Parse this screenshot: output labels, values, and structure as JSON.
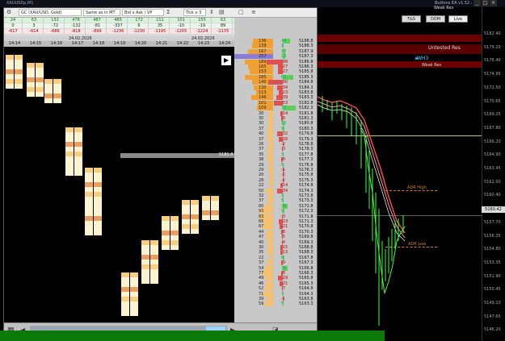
{
  "window": {
    "title": "XAUUSDp,M1",
    "buttons_ea_title": "Buttons EA v1.52 : Ho",
    "controls": [
      "_",
      "□",
      "×"
    ]
  },
  "toolbar": {
    "symbol": "GC (XAU/USD, Gold)",
    "feed": "Same as in MT",
    "mode": "Bid x Ask / VP",
    "tick": "Tick x 3"
  },
  "stats": {
    "rows": [
      [
        "24",
        "63",
        "132",
        "478",
        "487",
        "485",
        "172",
        "111",
        "101",
        "155",
        "63"
      ],
      [
        "0",
        "3",
        "-72",
        "-132",
        "-81",
        "-337",
        "6",
        "35",
        "-10",
        "-19",
        "89"
      ],
      [
        "-617",
        "-614",
        "-686",
        "-818",
        "-899",
        "-1236",
        "-1230",
        "-1195",
        "-1205",
        "-1224",
        "-1135"
      ]
    ]
  },
  "dates": {
    "left": "24.02.2026",
    "right": "24.02.2026"
  },
  "times": [
    "14:14",
    "14:15",
    "14:16",
    "14:17",
    "14:18",
    "14:19",
    "14:20",
    "14:21",
    "14:22",
    "14:23",
    "14:24"
  ],
  "fp_price_marker": "5181.6",
  "volume_profile": [
    {
      "p": "5188.8",
      "v": "136",
      "d": "44"
    },
    {
      "p": "5188.3",
      "v": "139",
      "d": "1"
    },
    {
      "p": "5187.9",
      "v": "167",
      "d": "17"
    },
    {
      "p": "5187.3",
      "v": "257",
      "d": "13"
    },
    {
      "p": "5186.8",
      "v": "189",
      "d": "-98"
    },
    {
      "p": "5186.3",
      "v": "165",
      "d": "-27"
    },
    {
      "p": "5185.8",
      "v": "153",
      "d": "-27"
    },
    {
      "p": "5185.3",
      "v": "185",
      "d": "62"
    },
    {
      "p": "5184.8",
      "v": "140",
      "d": "-90"
    },
    {
      "p": "5184.3",
      "v": "130",
      "d": "-34"
    },
    {
      "p": "5183.8",
      "v": "113",
      "d": "-23"
    },
    {
      "p": "5183.3",
      "v": "146",
      "d": "-39"
    },
    {
      "p": "5182.8",
      "v": "101",
      "d": "-53"
    },
    {
      "p": "5182.3",
      "v": "109",
      "d": "77"
    },
    {
      "p": "5181.8",
      "v": "30",
      "d": "-14"
    },
    {
      "p": "5181.3",
      "v": "30",
      "d": "-8"
    },
    {
      "p": "5180.8",
      "v": "30",
      "d": "12"
    },
    {
      "p": "5180.3",
      "v": "37",
      "d": "9"
    },
    {
      "p": "5179.8",
      "v": "40",
      "d": "-32"
    },
    {
      "p": "5179.3",
      "v": "37",
      "d": "-26"
    },
    {
      "p": "5178.8",
      "v": "26",
      "d": "-2"
    },
    {
      "p": "5178.3",
      "v": "37",
      "d": "-3"
    },
    {
      "p": "5177.8",
      "v": "35",
      "d": "3"
    },
    {
      "p": "5177.3",
      "v": "38",
      "d": "-8"
    },
    {
      "p": "5176.8",
      "v": "29",
      "d": "5"
    },
    {
      "p": "5176.3",
      "v": "29",
      "d": "-1"
    },
    {
      "p": "5175.8",
      "v": "20",
      "d": "-2"
    },
    {
      "p": "5175.3",
      "v": "28",
      "d": "-2"
    },
    {
      "p": "5174.8",
      "v": "22",
      "d": "-14"
    },
    {
      "p": "5174.3",
      "v": "50",
      "d": "-34"
    },
    {
      "p": "5173.8",
      "v": "32",
      "d": "2"
    },
    {
      "p": "5173.3",
      "v": "37",
      "d": "5"
    },
    {
      "p": "5172.8",
      "v": "60",
      "d": "30"
    },
    {
      "p": "5172.3",
      "v": "93",
      "d": "9"
    },
    {
      "p": "5171.8",
      "v": "83",
      "d": "-3"
    },
    {
      "p": "5171.3",
      "v": "66",
      "d": "-23"
    },
    {
      "p": "5170.8",
      "v": "67",
      "d": "-21"
    },
    {
      "p": "5170.3",
      "v": "44",
      "d": "-8"
    },
    {
      "p": "5169.8",
      "v": "47",
      "d": "-5"
    },
    {
      "p": "5169.3",
      "v": "40",
      "d": "-4"
    },
    {
      "p": "5168.8",
      "v": "30",
      "d": "-15"
    },
    {
      "p": "5168.3",
      "v": "35",
      "d": "-13"
    },
    {
      "p": "5167.8",
      "v": "22",
      "d": "8"
    },
    {
      "p": "5167.3",
      "v": "37",
      "d": "-9"
    },
    {
      "p": "5166.8",
      "v": "54",
      "d": "30"
    },
    {
      "p": "5166.3",
      "v": "77",
      "d": "-8"
    },
    {
      "p": "5165.8",
      "v": "49",
      "d": "-29"
    },
    {
      "p": "5165.3",
      "v": "46",
      "d": "-21"
    },
    {
      "p": "5164.8",
      "v": "52",
      "d": "-7"
    },
    {
      "p": "5164.3",
      "v": "71",
      "d": "7"
    },
    {
      "p": "5163.8",
      "v": "39",
      "d": "-1"
    },
    {
      "p": "5163.3",
      "v": "59",
      "d": "5"
    }
  ],
  "chart": {
    "labels": {
      "weak_res_1": "Weak Res",
      "untested_res": "Untested Res",
      "weak_res_2": "Weak Res",
      "wh3": "WH3",
      "adr_high": "ADR High",
      "adr_low": "ADR Low"
    },
    "buttons": {
      "ts": "T&S",
      "dom": "DOM",
      "live": "Live"
    },
    "price_scale": [
      "5182.40",
      "5179.20",
      "5176.40",
      "5174.95",
      "5172.50",
      "5170.65",
      "5169.25",
      "5167.80",
      "5166.20",
      "5164.90",
      "5163.45",
      "5162.00",
      "5160.40",
      "5159.15",
      "5157.70",
      "5156.25",
      "5154.80",
      "5153.35",
      "5151.90",
      "5150.45",
      "5149.10",
      "5147.65",
      "5146.20"
    ],
    "current_price": "5160.42"
  }
}
